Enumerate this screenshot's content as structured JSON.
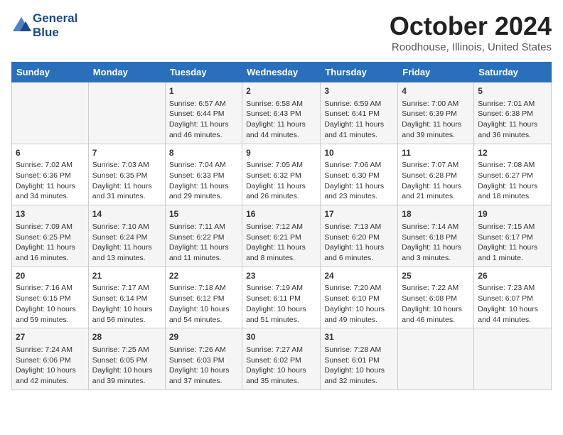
{
  "header": {
    "logo_line1": "General",
    "logo_line2": "Blue",
    "month": "October 2024",
    "location": "Roodhouse, Illinois, United States"
  },
  "weekdays": [
    "Sunday",
    "Monday",
    "Tuesday",
    "Wednesday",
    "Thursday",
    "Friday",
    "Saturday"
  ],
  "weeks": [
    [
      {
        "day": "",
        "sunrise": "",
        "sunset": "",
        "daylight": ""
      },
      {
        "day": "",
        "sunrise": "",
        "sunset": "",
        "daylight": ""
      },
      {
        "day": "1",
        "sunrise": "Sunrise: 6:57 AM",
        "sunset": "Sunset: 6:44 PM",
        "daylight": "Daylight: 11 hours and 46 minutes."
      },
      {
        "day": "2",
        "sunrise": "Sunrise: 6:58 AM",
        "sunset": "Sunset: 6:43 PM",
        "daylight": "Daylight: 11 hours and 44 minutes."
      },
      {
        "day": "3",
        "sunrise": "Sunrise: 6:59 AM",
        "sunset": "Sunset: 6:41 PM",
        "daylight": "Daylight: 11 hours and 41 minutes."
      },
      {
        "day": "4",
        "sunrise": "Sunrise: 7:00 AM",
        "sunset": "Sunset: 6:39 PM",
        "daylight": "Daylight: 11 hours and 39 minutes."
      },
      {
        "day": "5",
        "sunrise": "Sunrise: 7:01 AM",
        "sunset": "Sunset: 6:38 PM",
        "daylight": "Daylight: 11 hours and 36 minutes."
      }
    ],
    [
      {
        "day": "6",
        "sunrise": "Sunrise: 7:02 AM",
        "sunset": "Sunset: 6:36 PM",
        "daylight": "Daylight: 11 hours and 34 minutes."
      },
      {
        "day": "7",
        "sunrise": "Sunrise: 7:03 AM",
        "sunset": "Sunset: 6:35 PM",
        "daylight": "Daylight: 11 hours and 31 minutes."
      },
      {
        "day": "8",
        "sunrise": "Sunrise: 7:04 AM",
        "sunset": "Sunset: 6:33 PM",
        "daylight": "Daylight: 11 hours and 29 minutes."
      },
      {
        "day": "9",
        "sunrise": "Sunrise: 7:05 AM",
        "sunset": "Sunset: 6:32 PM",
        "daylight": "Daylight: 11 hours and 26 minutes."
      },
      {
        "day": "10",
        "sunrise": "Sunrise: 7:06 AM",
        "sunset": "Sunset: 6:30 PM",
        "daylight": "Daylight: 11 hours and 23 minutes."
      },
      {
        "day": "11",
        "sunrise": "Sunrise: 7:07 AM",
        "sunset": "Sunset: 6:28 PM",
        "daylight": "Daylight: 11 hours and 21 minutes."
      },
      {
        "day": "12",
        "sunrise": "Sunrise: 7:08 AM",
        "sunset": "Sunset: 6:27 PM",
        "daylight": "Daylight: 11 hours and 18 minutes."
      }
    ],
    [
      {
        "day": "13",
        "sunrise": "Sunrise: 7:09 AM",
        "sunset": "Sunset: 6:25 PM",
        "daylight": "Daylight: 11 hours and 16 minutes."
      },
      {
        "day": "14",
        "sunrise": "Sunrise: 7:10 AM",
        "sunset": "Sunset: 6:24 PM",
        "daylight": "Daylight: 11 hours and 13 minutes."
      },
      {
        "day": "15",
        "sunrise": "Sunrise: 7:11 AM",
        "sunset": "Sunset: 6:22 PM",
        "daylight": "Daylight: 11 hours and 11 minutes."
      },
      {
        "day": "16",
        "sunrise": "Sunrise: 7:12 AM",
        "sunset": "Sunset: 6:21 PM",
        "daylight": "Daylight: 11 hours and 8 minutes."
      },
      {
        "day": "17",
        "sunrise": "Sunrise: 7:13 AM",
        "sunset": "Sunset: 6:20 PM",
        "daylight": "Daylight: 11 hours and 6 minutes."
      },
      {
        "day": "18",
        "sunrise": "Sunrise: 7:14 AM",
        "sunset": "Sunset: 6:18 PM",
        "daylight": "Daylight: 11 hours and 3 minutes."
      },
      {
        "day": "19",
        "sunrise": "Sunrise: 7:15 AM",
        "sunset": "Sunset: 6:17 PM",
        "daylight": "Daylight: 11 hours and 1 minute."
      }
    ],
    [
      {
        "day": "20",
        "sunrise": "Sunrise: 7:16 AM",
        "sunset": "Sunset: 6:15 PM",
        "daylight": "Daylight: 10 hours and 59 minutes."
      },
      {
        "day": "21",
        "sunrise": "Sunrise: 7:17 AM",
        "sunset": "Sunset: 6:14 PM",
        "daylight": "Daylight: 10 hours and 56 minutes."
      },
      {
        "day": "22",
        "sunrise": "Sunrise: 7:18 AM",
        "sunset": "Sunset: 6:12 PM",
        "daylight": "Daylight: 10 hours and 54 minutes."
      },
      {
        "day": "23",
        "sunrise": "Sunrise: 7:19 AM",
        "sunset": "Sunset: 6:11 PM",
        "daylight": "Daylight: 10 hours and 51 minutes."
      },
      {
        "day": "24",
        "sunrise": "Sunrise: 7:20 AM",
        "sunset": "Sunset: 6:10 PM",
        "daylight": "Daylight: 10 hours and 49 minutes."
      },
      {
        "day": "25",
        "sunrise": "Sunrise: 7:22 AM",
        "sunset": "Sunset: 6:08 PM",
        "daylight": "Daylight: 10 hours and 46 minutes."
      },
      {
        "day": "26",
        "sunrise": "Sunrise: 7:23 AM",
        "sunset": "Sunset: 6:07 PM",
        "daylight": "Daylight: 10 hours and 44 minutes."
      }
    ],
    [
      {
        "day": "27",
        "sunrise": "Sunrise: 7:24 AM",
        "sunset": "Sunset: 6:06 PM",
        "daylight": "Daylight: 10 hours and 42 minutes."
      },
      {
        "day": "28",
        "sunrise": "Sunrise: 7:25 AM",
        "sunset": "Sunset: 6:05 PM",
        "daylight": "Daylight: 10 hours and 39 minutes."
      },
      {
        "day": "29",
        "sunrise": "Sunrise: 7:26 AM",
        "sunset": "Sunset: 6:03 PM",
        "daylight": "Daylight: 10 hours and 37 minutes."
      },
      {
        "day": "30",
        "sunrise": "Sunrise: 7:27 AM",
        "sunset": "Sunset: 6:02 PM",
        "daylight": "Daylight: 10 hours and 35 minutes."
      },
      {
        "day": "31",
        "sunrise": "Sunrise: 7:28 AM",
        "sunset": "Sunset: 6:01 PM",
        "daylight": "Daylight: 10 hours and 32 minutes."
      },
      {
        "day": "",
        "sunrise": "",
        "sunset": "",
        "daylight": ""
      },
      {
        "day": "",
        "sunrise": "",
        "sunset": "",
        "daylight": ""
      }
    ]
  ]
}
